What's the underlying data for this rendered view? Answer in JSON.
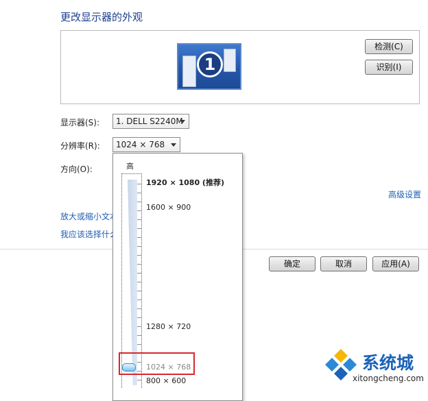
{
  "header": {
    "title": "更改显示器的外观"
  },
  "preview": {
    "monitor_number": "1",
    "detect_button": "检测(C)",
    "identify_button": "识别(I)"
  },
  "settings": {
    "display_label": "显示器(S):",
    "display_value": "1. DELL S2240M",
    "resolution_label": "分辨率(R):",
    "resolution_value": "1024 × 768",
    "orientation_label": "方向(O):",
    "advanced_link": "高级设置",
    "text_size_link": "放大或缩小文本",
    "which_settings_link": "我应该选择什么"
  },
  "resolution_dropdown": {
    "high_label": "高",
    "options": [
      {
        "label": "1920 × 1080 (推荐)",
        "recommended": true
      },
      {
        "label": "1600 × 900"
      },
      {
        "label": "1280 × 720"
      },
      {
        "label": "1024 × 768",
        "selected": true
      },
      {
        "label": "800 × 600"
      }
    ]
  },
  "footer": {
    "ok_button": "确定",
    "cancel_button": "取消",
    "apply_button": "应用(A)"
  },
  "watermark": {
    "brand": "系统城",
    "url": "xitongcheng.com"
  },
  "colors": {
    "highlight_box": "#d8262c",
    "link": "#1f5fb5",
    "title": "#1e3f8f"
  }
}
